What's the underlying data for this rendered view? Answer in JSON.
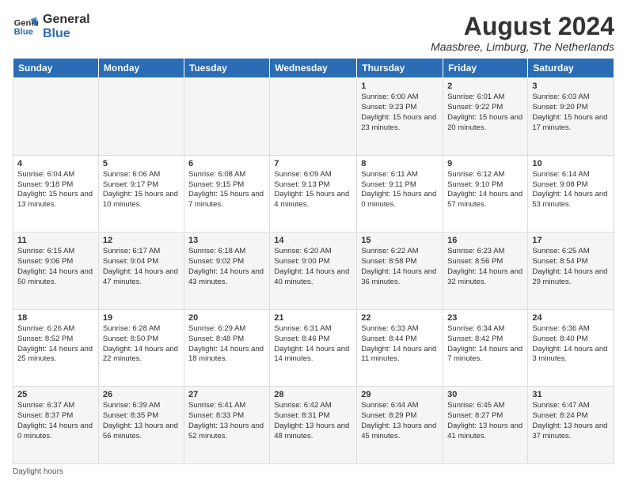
{
  "header": {
    "logo_line1": "General",
    "logo_line2": "Blue",
    "month_title": "August 2024",
    "location": "Maasbree, Limburg, The Netherlands"
  },
  "days_of_week": [
    "Sunday",
    "Monday",
    "Tuesday",
    "Wednesday",
    "Thursday",
    "Friday",
    "Saturday"
  ],
  "footer_text": "Daylight hours",
  "weeks": [
    [
      {
        "day": "",
        "info": ""
      },
      {
        "day": "",
        "info": ""
      },
      {
        "day": "",
        "info": ""
      },
      {
        "day": "",
        "info": ""
      },
      {
        "day": "1",
        "info": "Sunrise: 6:00 AM\nSunset: 9:23 PM\nDaylight: 15 hours\nand 23 minutes."
      },
      {
        "day": "2",
        "info": "Sunrise: 6:01 AM\nSunset: 9:22 PM\nDaylight: 15 hours\nand 20 minutes."
      },
      {
        "day": "3",
        "info": "Sunrise: 6:03 AM\nSunset: 9:20 PM\nDaylight: 15 hours\nand 17 minutes."
      }
    ],
    [
      {
        "day": "4",
        "info": "Sunrise: 6:04 AM\nSunset: 9:18 PM\nDaylight: 15 hours\nand 13 minutes."
      },
      {
        "day": "5",
        "info": "Sunrise: 6:06 AM\nSunset: 9:17 PM\nDaylight: 15 hours\nand 10 minutes."
      },
      {
        "day": "6",
        "info": "Sunrise: 6:08 AM\nSunset: 9:15 PM\nDaylight: 15 hours\nand 7 minutes."
      },
      {
        "day": "7",
        "info": "Sunrise: 6:09 AM\nSunset: 9:13 PM\nDaylight: 15 hours\nand 4 minutes."
      },
      {
        "day": "8",
        "info": "Sunrise: 6:11 AM\nSunset: 9:11 PM\nDaylight: 15 hours\nand 0 minutes."
      },
      {
        "day": "9",
        "info": "Sunrise: 6:12 AM\nSunset: 9:10 PM\nDaylight: 14 hours\nand 57 minutes."
      },
      {
        "day": "10",
        "info": "Sunrise: 6:14 AM\nSunset: 9:08 PM\nDaylight: 14 hours\nand 53 minutes."
      }
    ],
    [
      {
        "day": "11",
        "info": "Sunrise: 6:15 AM\nSunset: 9:06 PM\nDaylight: 14 hours\nand 50 minutes."
      },
      {
        "day": "12",
        "info": "Sunrise: 6:17 AM\nSunset: 9:04 PM\nDaylight: 14 hours\nand 47 minutes."
      },
      {
        "day": "13",
        "info": "Sunrise: 6:18 AM\nSunset: 9:02 PM\nDaylight: 14 hours\nand 43 minutes."
      },
      {
        "day": "14",
        "info": "Sunrise: 6:20 AM\nSunset: 9:00 PM\nDaylight: 14 hours\nand 40 minutes."
      },
      {
        "day": "15",
        "info": "Sunrise: 6:22 AM\nSunset: 8:58 PM\nDaylight: 14 hours\nand 36 minutes."
      },
      {
        "day": "16",
        "info": "Sunrise: 6:23 AM\nSunset: 8:56 PM\nDaylight: 14 hours\nand 32 minutes."
      },
      {
        "day": "17",
        "info": "Sunrise: 6:25 AM\nSunset: 8:54 PM\nDaylight: 14 hours\nand 29 minutes."
      }
    ],
    [
      {
        "day": "18",
        "info": "Sunrise: 6:26 AM\nSunset: 8:52 PM\nDaylight: 14 hours\nand 25 minutes."
      },
      {
        "day": "19",
        "info": "Sunrise: 6:28 AM\nSunset: 8:50 PM\nDaylight: 14 hours\nand 22 minutes."
      },
      {
        "day": "20",
        "info": "Sunrise: 6:29 AM\nSunset: 8:48 PM\nDaylight: 14 hours\nand 18 minutes."
      },
      {
        "day": "21",
        "info": "Sunrise: 6:31 AM\nSunset: 8:46 PM\nDaylight: 14 hours\nand 14 minutes."
      },
      {
        "day": "22",
        "info": "Sunrise: 6:33 AM\nSunset: 8:44 PM\nDaylight: 14 hours\nand 11 minutes."
      },
      {
        "day": "23",
        "info": "Sunrise: 6:34 AM\nSunset: 8:42 PM\nDaylight: 14 hours\nand 7 minutes."
      },
      {
        "day": "24",
        "info": "Sunrise: 6:36 AM\nSunset: 8:40 PM\nDaylight: 14 hours\nand 3 minutes."
      }
    ],
    [
      {
        "day": "25",
        "info": "Sunrise: 6:37 AM\nSunset: 8:37 PM\nDaylight: 14 hours\nand 0 minutes."
      },
      {
        "day": "26",
        "info": "Sunrise: 6:39 AM\nSunset: 8:35 PM\nDaylight: 13 hours\nand 56 minutes."
      },
      {
        "day": "27",
        "info": "Sunrise: 6:41 AM\nSunset: 8:33 PM\nDaylight: 13 hours\nand 52 minutes."
      },
      {
        "day": "28",
        "info": "Sunrise: 6:42 AM\nSunset: 8:31 PM\nDaylight: 13 hours\nand 48 minutes."
      },
      {
        "day": "29",
        "info": "Sunrise: 6:44 AM\nSunset: 8:29 PM\nDaylight: 13 hours\nand 45 minutes."
      },
      {
        "day": "30",
        "info": "Sunrise: 6:45 AM\nSunset: 8:27 PM\nDaylight: 13 hours\nand 41 minutes."
      },
      {
        "day": "31",
        "info": "Sunrise: 6:47 AM\nSunset: 8:24 PM\nDaylight: 13 hours\nand 37 minutes."
      }
    ]
  ]
}
